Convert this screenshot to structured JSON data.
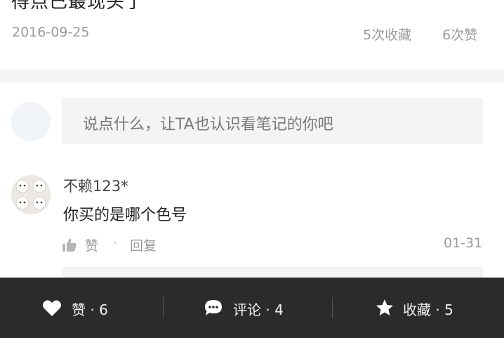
{
  "note": {
    "top_text_cut": "得点已最现头了",
    "date": "2016-09-25",
    "favorites_text": "5次收藏",
    "likes_text": "6次赞"
  },
  "comment_input": {
    "placeholder": "说点什么，让TA也认识看笔记的你吧"
  },
  "comments": [
    {
      "username": "不赖123*",
      "text": "你买的是哪个色号",
      "like_label": "赞",
      "separator": "·",
      "reply_label": "回复",
      "date": "01-31"
    }
  ],
  "bottom_bar": {
    "like": {
      "label": "赞 · 6",
      "icon": "heart-icon"
    },
    "comment": {
      "label": "评论 · 4",
      "icon": "chat-bubble-icon"
    },
    "favorite": {
      "label": "收藏 · 5",
      "icon": "star-icon"
    }
  },
  "colors": {
    "bottom_bar_bg": "#2b2b2b",
    "muted_text": "#9b9b9b",
    "input_bg": "#f4f4f6"
  }
}
